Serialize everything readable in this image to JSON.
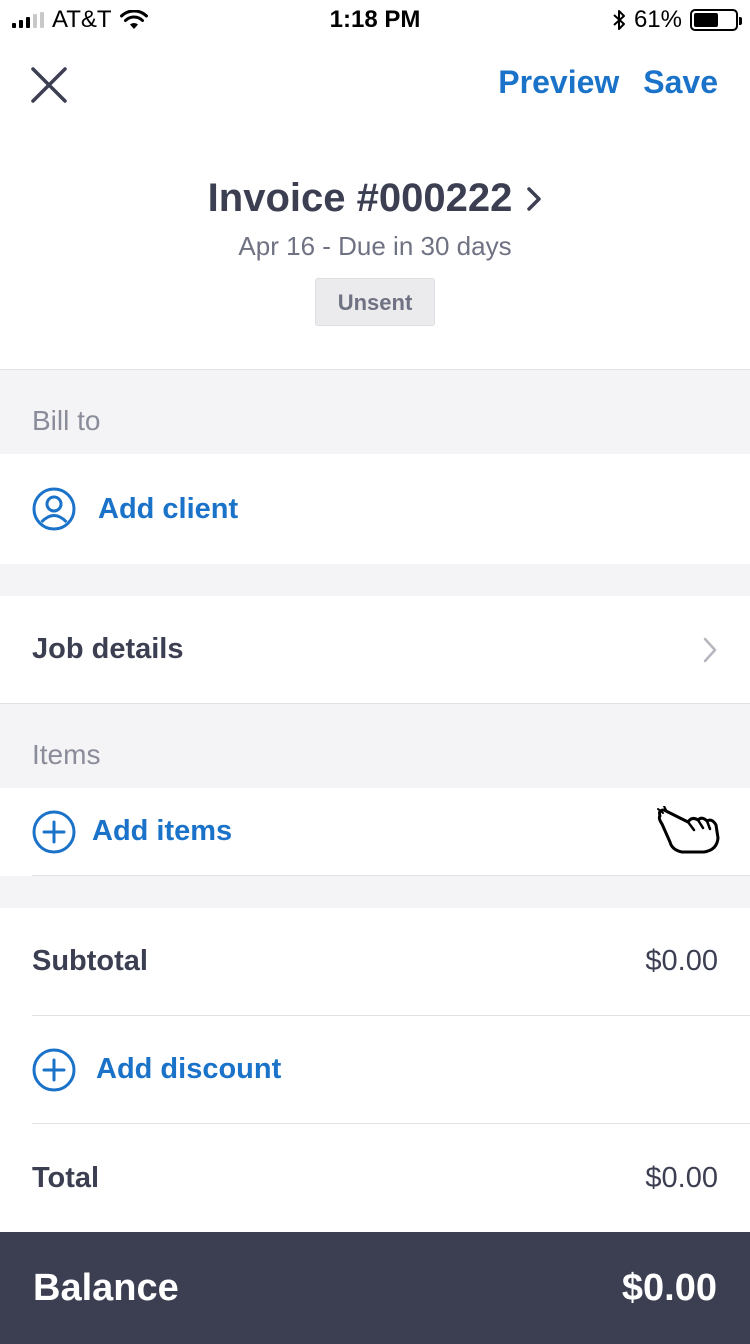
{
  "status_bar": {
    "carrier": "AT&T",
    "time": "1:18 PM",
    "battery": "61%",
    "battery_level": 0.61
  },
  "nav": {
    "preview_label": "Preview",
    "save_label": "Save"
  },
  "invoice": {
    "title": "Invoice #000222",
    "subtitle": "Apr 16 - Due in 30 days",
    "status": "Unsent"
  },
  "bill_to": {
    "section_label": "Bill to",
    "add_client_label": "Add client"
  },
  "job_details": {
    "label": "Job details"
  },
  "items": {
    "section_label": "Items",
    "add_items_label": "Add items"
  },
  "totals": {
    "subtotal_label": "Subtotal",
    "subtotal_value": "$0.00",
    "add_discount_label": "Add discount",
    "total_label": "Total",
    "total_value": "$0.00"
  },
  "balance": {
    "label": "Balance",
    "value": "$0.00"
  },
  "colors": {
    "accent": "#1a73c9",
    "text": "#3c3f52",
    "balance_bar": "#3c3f52",
    "section_bg": "#f4f4f6"
  }
}
